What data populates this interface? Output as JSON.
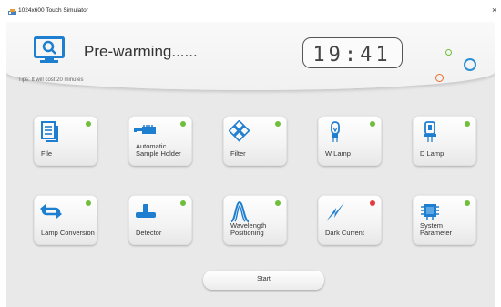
{
  "window": {
    "title": "1024x600 Touch Simulator",
    "close_glyph": "×"
  },
  "header": {
    "status_title": "Pre-warming......",
    "tips": "Tips: It will cost 20 minutes",
    "clock": "19:41",
    "icon": "monitor-search-icon"
  },
  "colors": {
    "accent_blue": "#1e7fd0",
    "ready_green": "#6fbf3a",
    "error_red": "#e23c3c",
    "deco_orange": "#ee6a2a"
  },
  "tiles": [
    {
      "label": "File",
      "icon": "document-stack-icon",
      "status": "green"
    },
    {
      "label": "Automatic Sample Holder",
      "icon": "sample-holder-icon",
      "status": "green"
    },
    {
      "label": "Filter",
      "icon": "filter-wheel-icon",
      "status": "green"
    },
    {
      "label": "W Lamp",
      "icon": "w-lamp-icon",
      "status": "green"
    },
    {
      "label": "D Lamp",
      "icon": "d-lamp-icon",
      "status": "green"
    },
    {
      "label": "Lamp Conversion",
      "icon": "swap-arrows-icon",
      "status": "green"
    },
    {
      "label": "Detector",
      "icon": "detector-icon",
      "status": "green"
    },
    {
      "label": "Wavelength Positioning",
      "icon": "wavelength-peak-icon",
      "status": "green"
    },
    {
      "label": "Dark Current",
      "icon": "lightning-icon",
      "status": "red"
    },
    {
      "label": "System Parameter",
      "icon": "chip-icon",
      "status": "green"
    }
  ],
  "start_button": {
    "label": "Start"
  }
}
